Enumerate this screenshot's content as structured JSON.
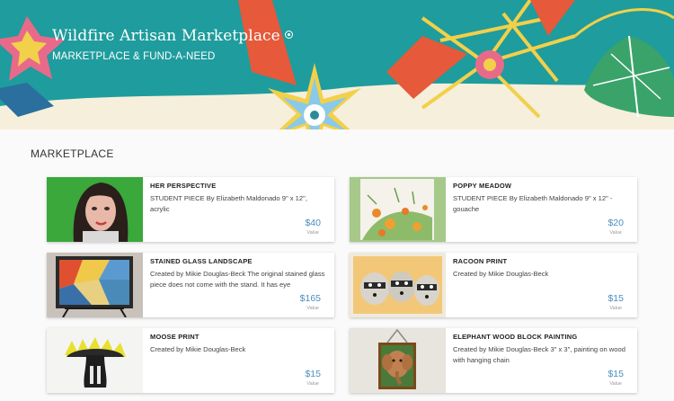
{
  "banner": {
    "title": "Wildfire Artisan Marketplace",
    "subtitle": "MARKETPLACE & FUND-A-NEED"
  },
  "section": {
    "heading": "MARKETPLACE"
  },
  "value_label": "Value",
  "items": [
    {
      "title": "HER PERSPECTIVE",
      "description": "STUDENT PIECE By Elizabeth Maldonado 9\" x 12\", acrylic",
      "price": "$40"
    },
    {
      "title": "POPPY MEADOW",
      "description": "STUDENT PIECE By Elizabeth Maldonado 9\" x 12\" - gouache",
      "price": "$20"
    },
    {
      "title": "STAINED GLASS LANDSCAPE",
      "description": "Created by Mikie Douglas-Beck The original stained glass piece does not come with the stand. It has eye",
      "price": "$165"
    },
    {
      "title": "RACOON PRINT",
      "description": "Created by Mikie Douglas-Beck",
      "price": "$15"
    },
    {
      "title": "MOOSE PRINT",
      "description": "Created by Mikie Douglas-Beck",
      "price": "$15"
    },
    {
      "title": "ELEPHANT WOOD BLOCK PAINTING",
      "description": "Created by Mikie Douglas-Beck 3\" x 3\", painting on wood with hanging chain",
      "price": "$15"
    }
  ],
  "colors": {
    "banner_teal": "#1f9c9d",
    "price_blue": "#4a8ec0"
  },
  "icons": {
    "title_badge": "info-circle-icon"
  }
}
